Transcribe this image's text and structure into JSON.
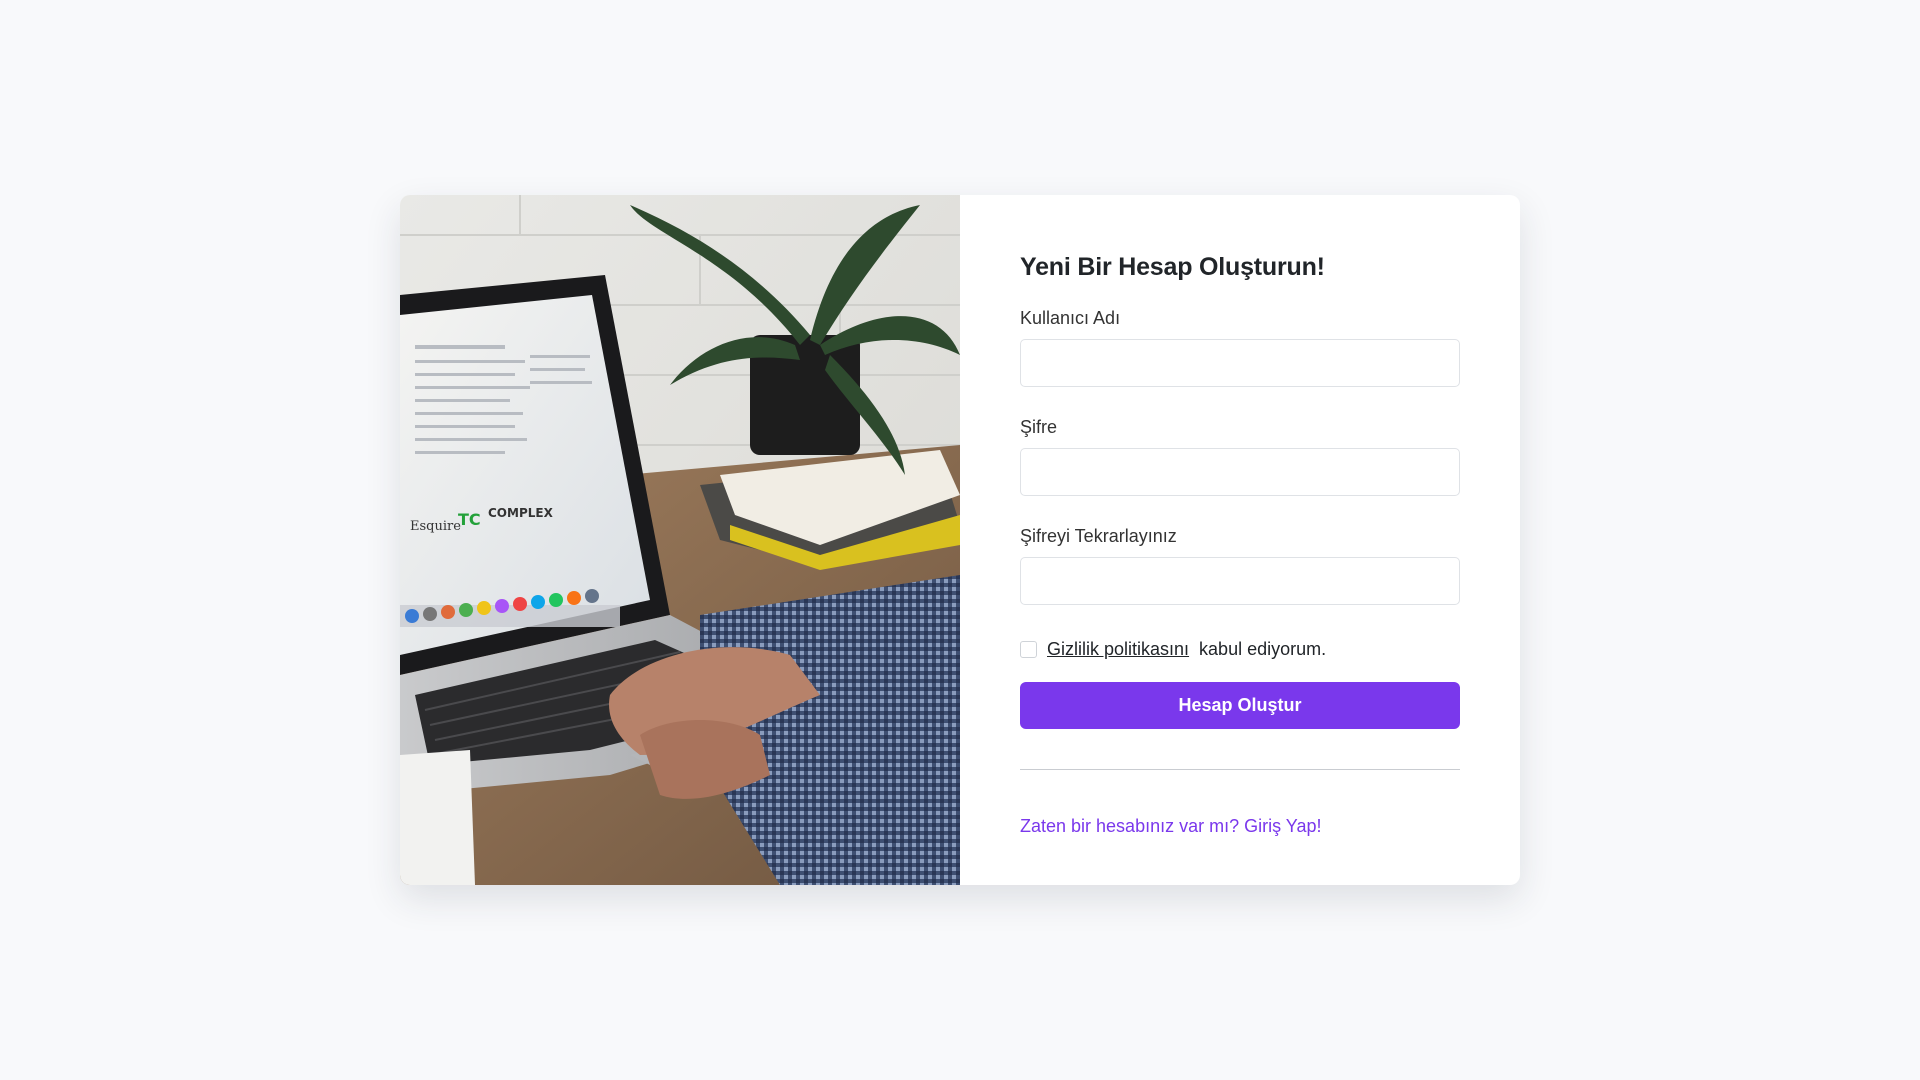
{
  "photo": {
    "description_icon": "laptop-photo"
  },
  "form": {
    "title": "Yeni Bir Hesap Oluşturun!",
    "username_label": "Kullanıcı Adı",
    "username_value": "",
    "password_label": "Şifre",
    "password_value": "",
    "password_repeat_label": "Şifreyi Tekrarlayınız",
    "password_repeat_value": "",
    "policy_link": "Gizlilik politikasını",
    "policy_suffix": "kabul ediyorum.",
    "submit_label": "Hesap Oluştur",
    "login_link": "Zaten bir hesabınız var mı? Giriş Yap!"
  },
  "colors": {
    "accent": "#7a38ec",
    "background": "#f8f9fb"
  }
}
